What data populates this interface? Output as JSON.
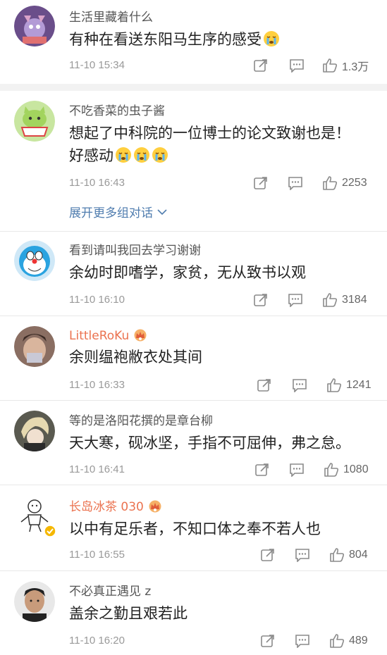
{
  "comments": [
    {
      "name": "生活里藏着什么",
      "text": "有种在看送东阳马生序的感受",
      "emoji_count": 1,
      "time": "11-10 15:34",
      "likes": "1.3万",
      "name_color": "gray"
    },
    {
      "name": "不吃香菜的虫子酱",
      "text": "想起了中科院的一位博士的论文致谢也是！好感动",
      "emoji_count": 3,
      "time": "11-10 16:43",
      "likes": "2253",
      "name_color": "gray"
    },
    {
      "name": "看到请叫我回去学习谢谢",
      "text": "余幼时即嗜学，家贫，无从致书以观",
      "time": "11-10 16:10",
      "likes": "3184",
      "name_color": "gray"
    },
    {
      "name": "LittleRoKu",
      "text": "余则缊袍敝衣处其间",
      "time": "11-10 16:33",
      "likes": "1241",
      "name_color": "orange",
      "badge": "crown-icon"
    },
    {
      "name": "等的是洛阳花撰的是章台柳",
      "text": "天大寒，砚冰坚，手指不可屈伸，弗之怠。",
      "time": "11-10 16:41",
      "likes": "1080",
      "name_color": "gray"
    },
    {
      "name": "长岛冰茶 030",
      "text": "以中有足乐者，不知口体之奉不若人也",
      "time": "11-10 16:55",
      "likes": "804",
      "name_color": "orange",
      "badge": "crown-icon",
      "verified": true
    },
    {
      "name": "不必真正遇见 z",
      "text": "盖余之勤且艰若此",
      "time": "11-10 16:20",
      "likes": "489",
      "name_color": "gray"
    }
  ],
  "expand_label": "展开更多组对话",
  "colors": {
    "orange": "#eb7350",
    "link": "#507daf",
    "time": "#999999"
  }
}
